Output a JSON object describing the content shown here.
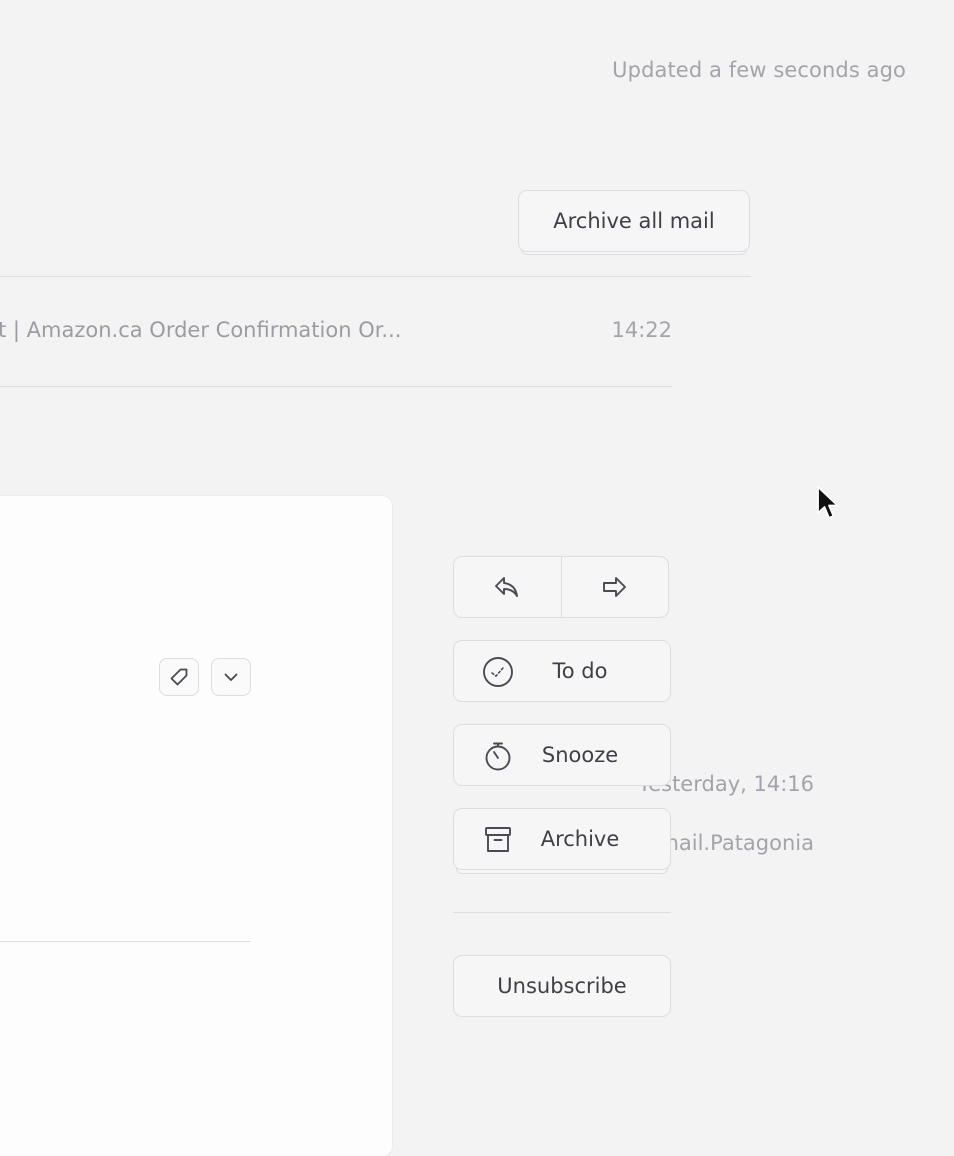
{
  "header": {
    "status_text": "Updated a few seconds ago",
    "archive_all_label": "Archive all mail"
  },
  "mail_list": [
    {
      "subject": "t | Amazon.ca Order Confirmation Or...",
      "time": "14:22"
    }
  ],
  "message": {
    "date": "Yesterday, 14:16",
    "sender": "Email.Patagonia",
    "icons": [
      "tag-icon",
      "chevron-down-icon"
    ]
  },
  "actions": {
    "reply_icon": "reply-icon",
    "forward_icon": "forward-icon",
    "todo_label": "To do",
    "snooze_label": "Snooze",
    "archive_label": "Archive",
    "unsubscribe_label": "Unsubscribe"
  },
  "colors": {
    "background": "#f3f3f3",
    "card": "#fdfdfd",
    "border": "#dcdce2",
    "text_muted": "#a3a3ab",
    "text": "#3f3f48"
  }
}
